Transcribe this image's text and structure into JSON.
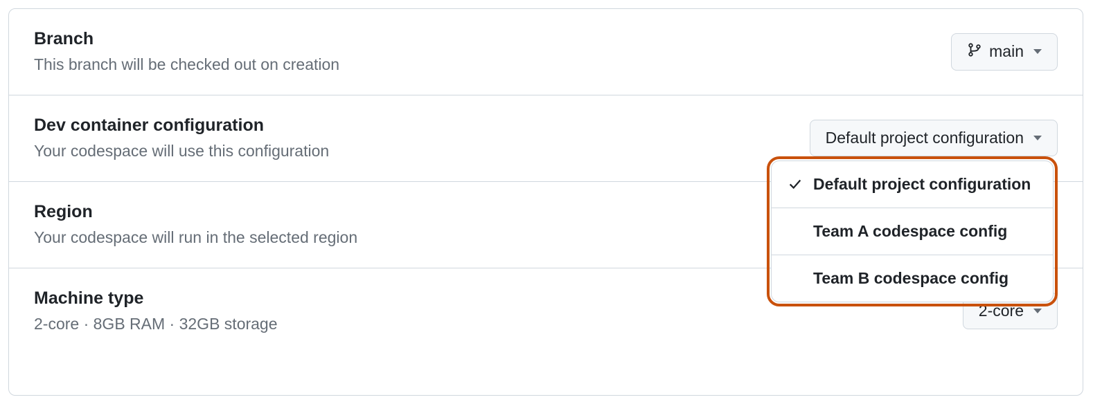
{
  "branch": {
    "title": "Branch",
    "subtitle": "This branch will be checked out on creation",
    "selected": "main"
  },
  "dev_container": {
    "title": "Dev container configuration",
    "subtitle": "Your codespace will use this configuration",
    "selected": "Default project configuration",
    "options": [
      {
        "label": "Default project configuration",
        "selected": true
      },
      {
        "label": "Team A codespace config",
        "selected": false
      },
      {
        "label": "Team B codespace config",
        "selected": false
      }
    ]
  },
  "region": {
    "title": "Region",
    "subtitle": "Your codespace will run in the selected region"
  },
  "machine": {
    "title": "Machine type",
    "subtitle": "2-core · 8GB RAM · 32GB storage",
    "selected": "2-core"
  }
}
